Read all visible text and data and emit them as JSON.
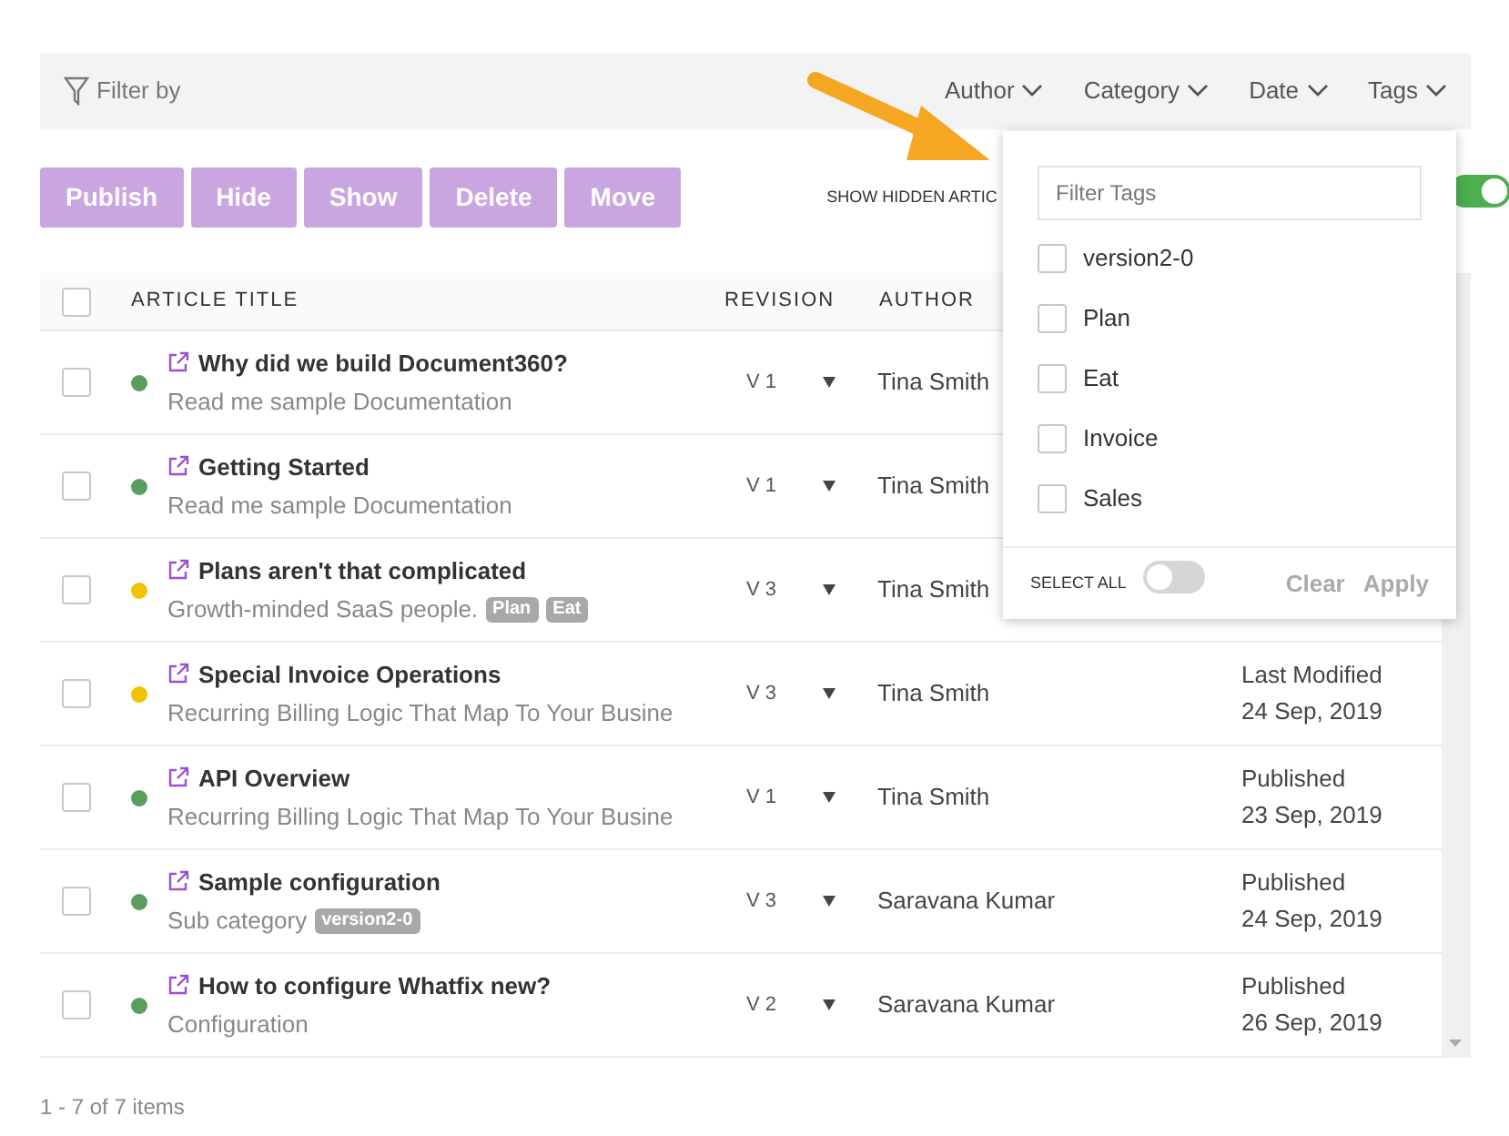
{
  "filter_bar": {
    "label": "Filter by",
    "filters": [
      {
        "label": "Author"
      },
      {
        "label": "Category"
      },
      {
        "label": "Date"
      },
      {
        "label": "Tags"
      }
    ]
  },
  "actions": [
    "Publish",
    "Hide",
    "Show",
    "Delete",
    "Move"
  ],
  "show_hidden": {
    "label": "SHOW HIDDEN ARTIC",
    "on": true
  },
  "table": {
    "all_checked": false,
    "columns": [
      "ARTICLE TITLE",
      "REVISION",
      "AUTHOR"
    ],
    "rows": [
      {
        "checked": false,
        "title": "Why did we build Document360?",
        "description": "Read me sample Documentation",
        "tags": [],
        "color": "#5a9e5e",
        "revision": "V 1",
        "author": "Tina Smith"
      },
      {
        "checked": false,
        "title": "Getting Started",
        "description": "Read me sample Documentation",
        "tags": [],
        "color": "#5a9e5e",
        "revision": "V 1",
        "author": "Tina Smith"
      },
      {
        "checked": false,
        "title": "Plans aren't that complicated",
        "description": "Growth-minded SaaS people.",
        "tags": [
          "Plan",
          "Eat"
        ],
        "color": "#f2c300",
        "revision": "V 3",
        "author": "Tina Smith"
      },
      {
        "checked": false,
        "title": "Special Invoice Operations",
        "description": "Recurring Billing Logic That Map To Your Busine",
        "tags": [],
        "color": "#f2c300",
        "revision": "V 3",
        "author": "Tina Smith",
        "status": "Last Modified",
        "date": "24 Sep, 2019"
      },
      {
        "checked": false,
        "title": "API Overview",
        "description": "Recurring Billing Logic That Map To Your Busine",
        "tags": [],
        "color": "#5a9e5e",
        "revision": "V 1",
        "author": "Tina Smith",
        "status": "Published",
        "date": "23 Sep, 2019"
      },
      {
        "checked": false,
        "title": "Sample configuration",
        "description": "Sub category",
        "tags": [
          "version2-0"
        ],
        "color": "#5a9e5e",
        "revision": "V 3",
        "author": "Saravana Kumar",
        "status": "Published",
        "date": "24 Sep, 2019"
      },
      {
        "checked": false,
        "title": "How to configure Whatfix new?",
        "description": "Configuration",
        "tags": [],
        "color": "#5a9e5e",
        "revision": "V 2",
        "author": "Saravana Kumar",
        "status": "Published",
        "date": "26 Sep, 2019"
      }
    ]
  },
  "pagination": "1 - 7 of 7 items",
  "tags_dropdown": {
    "placeholder": "Filter Tags",
    "options": [
      {
        "label": "version2-0",
        "checked": false
      },
      {
        "label": "Plan",
        "checked": false
      },
      {
        "label": "Eat",
        "checked": false
      },
      {
        "label": "Invoice",
        "checked": false
      },
      {
        "label": "Sales",
        "checked": false
      }
    ],
    "select_all": {
      "label": "SELECT ALL",
      "on": false
    },
    "buttons": [
      "Clear",
      "Apply"
    ]
  }
}
